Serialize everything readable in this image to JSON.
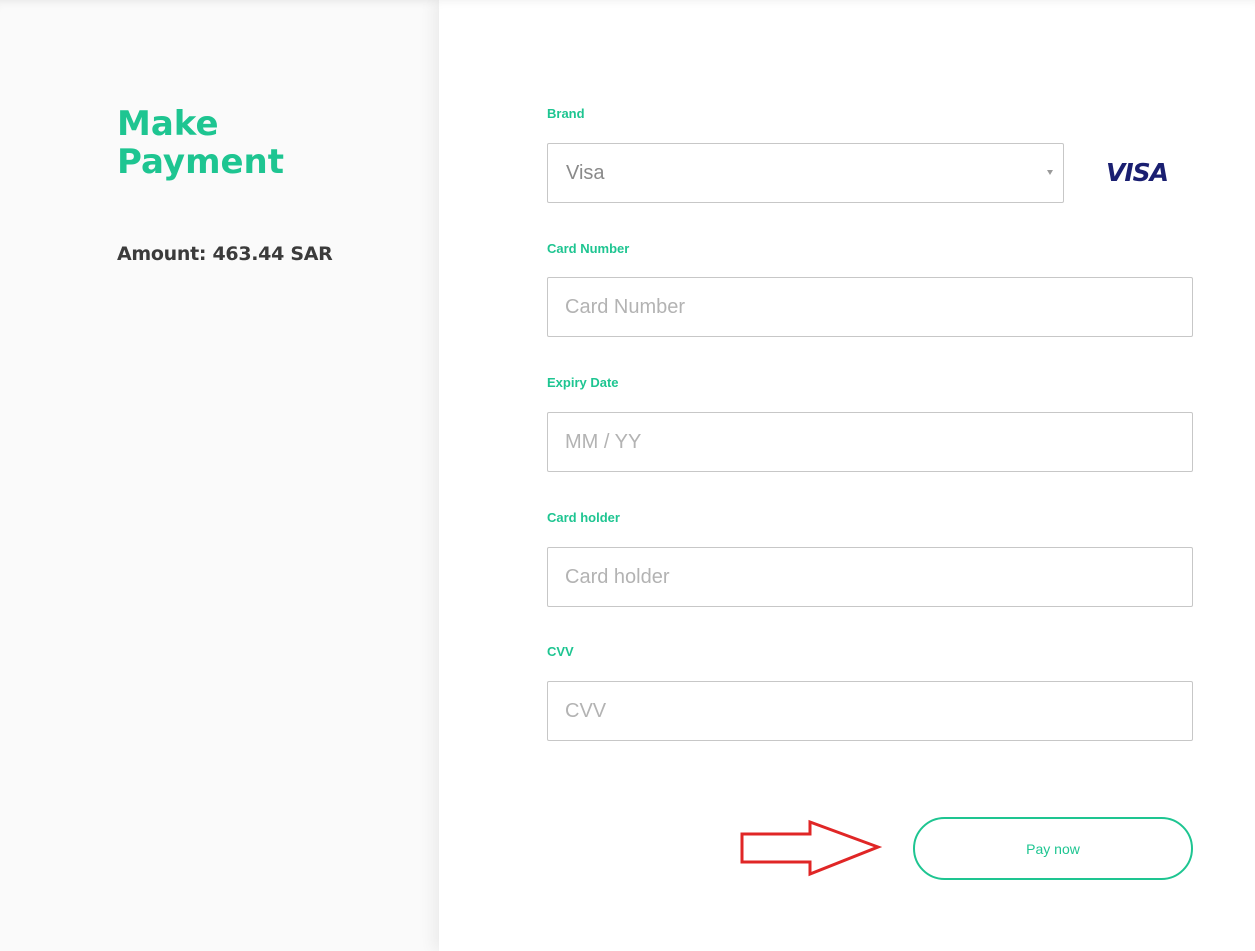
{
  "page": {
    "title_line1": "Make",
    "title_line2": "Payment",
    "amount": "Amount: 463.44 SAR"
  },
  "form": {
    "brand": {
      "label": "Brand",
      "selected": "Visa",
      "logo_text": "VISA"
    },
    "card_number": {
      "label": "Card Number",
      "placeholder": "Card Number"
    },
    "expiry": {
      "label": "Expiry Date",
      "placeholder": "MM / YY"
    },
    "card_holder": {
      "label": "Card holder",
      "placeholder": "Card holder"
    },
    "cvv": {
      "label": "CVV",
      "placeholder": "CVV"
    },
    "submit_label": "Pay now"
  },
  "annotation": {
    "arrow_icon": "right-arrow-icon",
    "arrow_color": "#e02626"
  },
  "colors": {
    "accent": "#1ec591",
    "text_dark": "#3b3b3b",
    "visa_blue": "#1a1f71"
  }
}
